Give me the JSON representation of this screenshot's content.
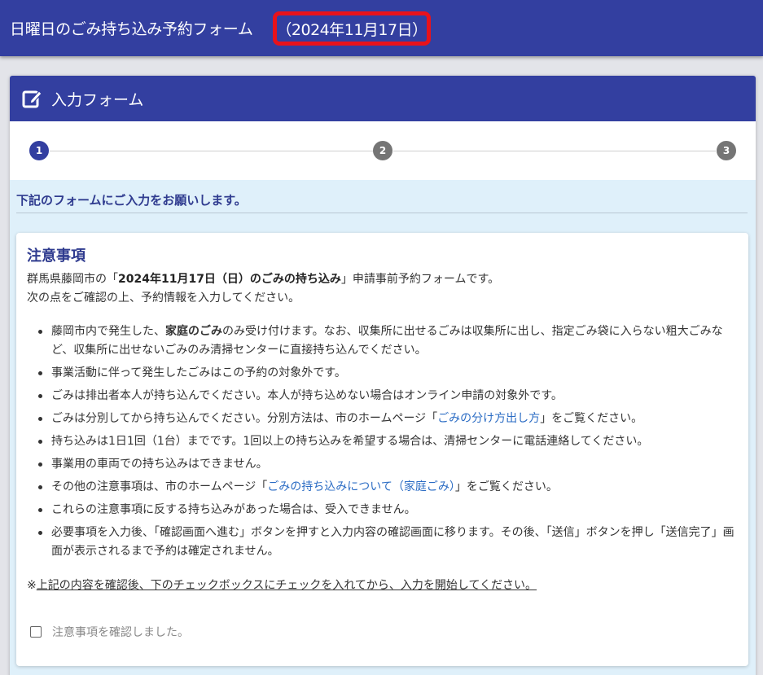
{
  "header": {
    "title": "日曜日のごみ持ち込み予約フォーム",
    "date": "（2024年11月17日）"
  },
  "form_card": {
    "title": "入力フォーム",
    "icon": "edit-icon"
  },
  "stepper": {
    "steps": [
      "1",
      "2",
      "3"
    ],
    "active_step": "1",
    "active_color": "#333fa0",
    "inactive_color": "#757575"
  },
  "instruction": "下記のフォームにご入力をお願いします。",
  "notice": {
    "title": "注意事項",
    "intro_line1_prefix": "群馬県藤岡市の「",
    "intro_line1_bold": "2024年11月17日（日）のごみの持ち込み",
    "intro_line1_suffix": "」申請事前予約フォームです。",
    "intro_line2": "次の点をご確認の上、予約情報を入力してください。",
    "items": [
      {
        "prefix": "藤岡市内で発生した、",
        "bold": "家庭のごみ",
        "text": "のみ受け付けます。なお、収集所に出せるごみは収集所に出し、指定ごみ袋に入らない粗大ごみなど、収集所に出せないごみのみ清掃センターに直接持ち込んでください。"
      },
      {
        "text": "事業活動に伴って発生したごみはこの予約の対象外です。"
      },
      {
        "text": "ごみは排出者本人が持ち込んでください。本人が持ち込めない場合はオンライン申請の対象外です。"
      },
      {
        "prefix": "ごみは分別してから持ち込んでください。分別方法は、市のホームページ「",
        "link": "ごみの分け方出し方",
        "suffix": "」をご覧ください。"
      },
      {
        "text": "持ち込みは1日1回（1台）までです。1回以上の持ち込みを希望する場合は、清掃センターに電話連絡してください。"
      },
      {
        "text": "事業用の車両での持ち込みはできません。"
      },
      {
        "prefix": "その他の注意事項は、市のホームページ「",
        "link": "ごみの持ち込みについて（家庭ごみ）",
        "suffix": "」をご覧ください。"
      },
      {
        "text": "これらの注意事項に反する持ち込みがあった場合は、受入できません。"
      },
      {
        "text": "必要事項を入力後、「確認画面へ進む」ボタンを押すと入力内容の確認画面に移ります。その後、「送信」ボタンを押し「送信完了」画面が表示されるまで予約は確定されません。"
      }
    ],
    "confirm_prefix": "※",
    "confirm_text": "上記の内容を確認後、下のチェックボックスにチェックを入れてから、入力を開始してください。",
    "checkbox_label": "注意事項を確認しました。",
    "checkbox_checked": false
  },
  "colors": {
    "brand": "#333fa0",
    "highlight": "#e8121b",
    "link": "#2b6cc4",
    "section_bg": "#dff0fa"
  }
}
